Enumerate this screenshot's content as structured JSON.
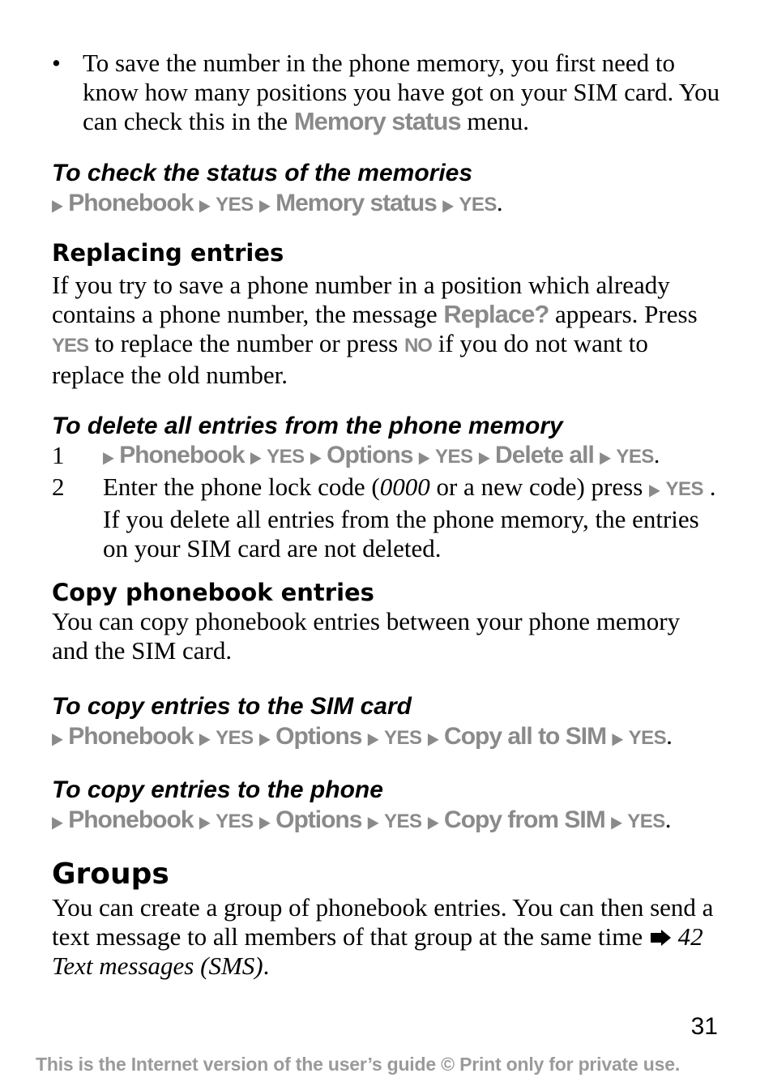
{
  "intro_bullet": {
    "bullet": "•",
    "text_before": "To save the number in the phone memory, you first need to know how many positions you have got on your SIM card. You can check this in the ",
    "menu_term": "Memory status",
    "text_after": " menu."
  },
  "check_status": {
    "heading": "To check the status of the memories",
    "nav": [
      "Phonebook",
      "YES",
      "Memory status",
      "YES"
    ],
    "end": "."
  },
  "replacing": {
    "heading": "Replacing entries",
    "p1": "If you try to save a phone number in a position which already contains a phone number, the message ",
    "term1": "Replace?",
    "p2": " appears. Press ",
    "key_yes": "YES",
    "p3": " to replace the number or press ",
    "key_no": "NO",
    "p4": " if you do not want to replace the old number."
  },
  "delete_all": {
    "heading": "To delete all entries from the phone memory",
    "steps": [
      {
        "num": "1",
        "nav": [
          "Phonebook",
          "YES",
          "Options",
          "YES",
          "Delete all",
          "YES"
        ],
        "end": "."
      },
      {
        "num": "2",
        "text_before": "Enter the phone lock code (",
        "code": "0000",
        "text_mid": " or a new code) press ",
        "key": "YES",
        "text_after": " . If you delete all entries from the phone memory, the entries on your SIM card are not deleted."
      }
    ]
  },
  "copy": {
    "heading": "Copy phonebook entries",
    "text": "You can copy phonebook entries between your phone memory and the SIM card."
  },
  "copy_to_sim": {
    "heading": "To copy entries to the SIM card",
    "nav": [
      "Phonebook",
      "YES",
      "Options",
      "YES",
      "Copy all to SIM",
      "YES"
    ],
    "end": "."
  },
  "copy_to_phone": {
    "heading": "To copy entries to the phone",
    "nav": [
      "Phonebook",
      "YES",
      "Options",
      "YES",
      "Copy from SIM",
      "YES"
    ],
    "end": "."
  },
  "groups": {
    "heading": "Groups",
    "text": "You can create a group of phonebook entries. You can then send a text message to all members of that group at the same time ",
    "reference": "42 Text messages (SMS)",
    "end": "."
  },
  "page_number": "31",
  "footer": "This is the Internet version of the user’s guide © Print only for private use.",
  "icons": {
    "nav_arrow": "▶",
    "reference_arrow": "right-arrow"
  },
  "colors": {
    "menu_text": "#8a8a8a",
    "footer_text": "#9a9a9a"
  }
}
